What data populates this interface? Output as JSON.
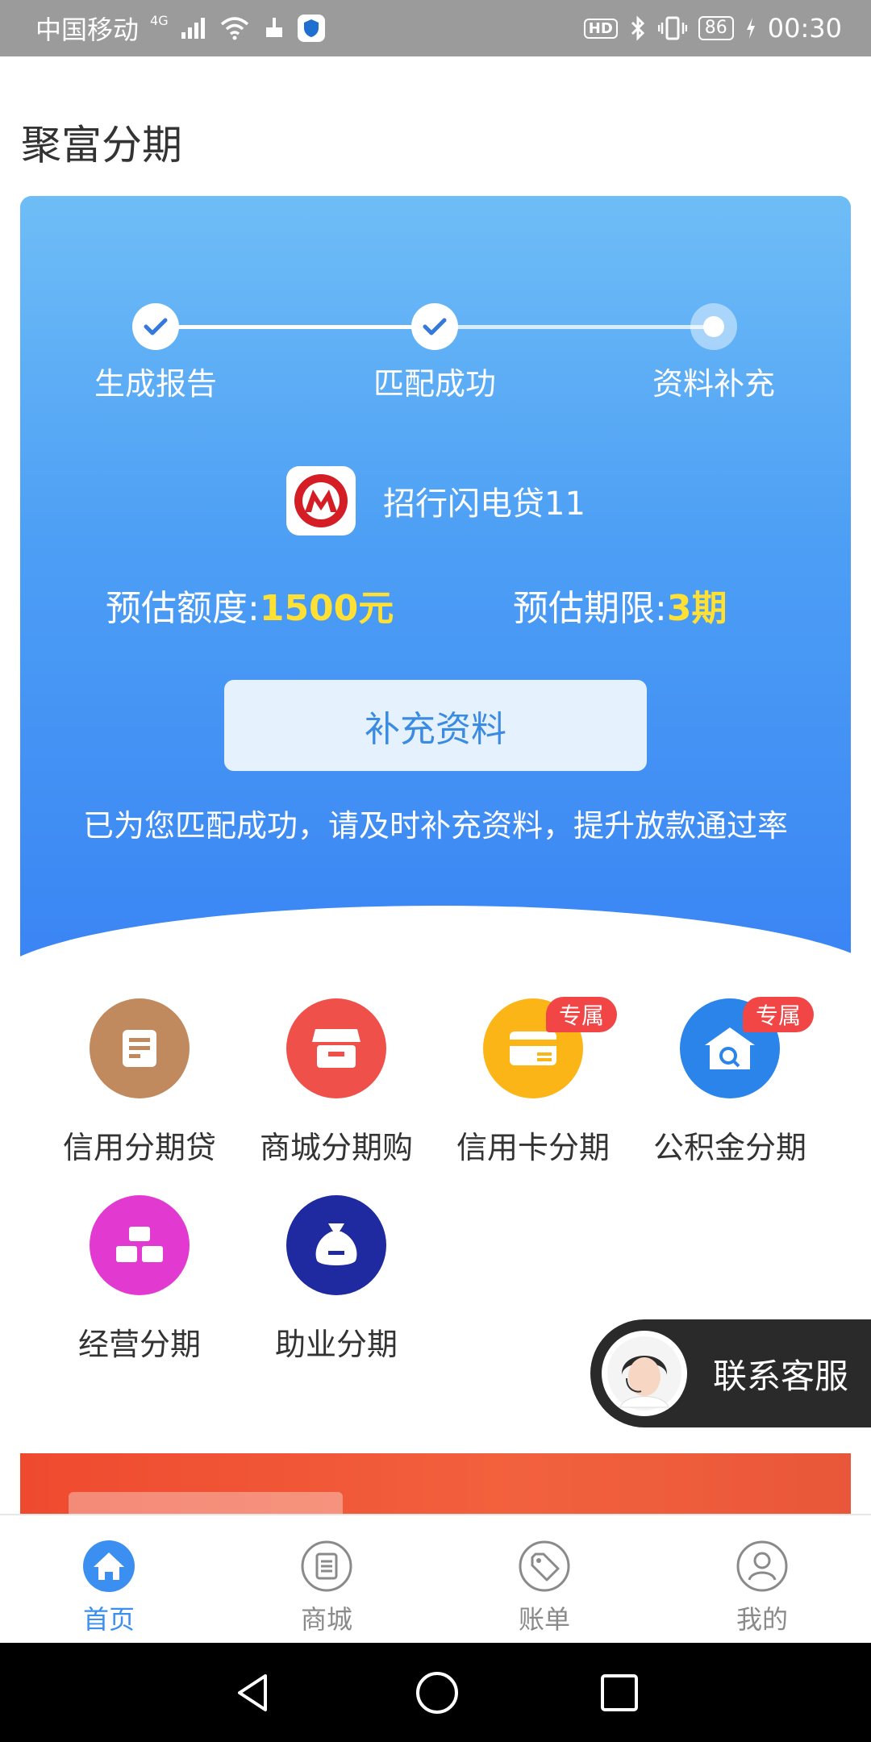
{
  "status_bar": {
    "carrier": "中国移动",
    "network": "4G",
    "hd": "HD",
    "battery": "86",
    "time": "00:30"
  },
  "header": {
    "title": "聚富分期"
  },
  "progress": {
    "steps": [
      {
        "label": "生成报告",
        "state": "done"
      },
      {
        "label": "匹配成功",
        "state": "done"
      },
      {
        "label": "资料补充",
        "state": "current"
      }
    ]
  },
  "loan": {
    "bank_name": "招行闪电贷11",
    "amount_label": "预估额度:",
    "amount_value": "1500元",
    "term_label": "预估期限:",
    "term_value": "3期",
    "action_label": "补充资料",
    "hint": "已为您匹配成功，请及时补充资料，提升放款通过率"
  },
  "menu": [
    {
      "label": "信用分期贷",
      "icon": "document-icon",
      "color": "#c08a5e",
      "badge": ""
    },
    {
      "label": "商城分期购",
      "icon": "store-icon",
      "color": "#f0504a",
      "badge": ""
    },
    {
      "label": "信用卡分期",
      "icon": "credit-card-icon",
      "color": "#fcb516",
      "badge": "专属"
    },
    {
      "label": "公积金分期",
      "icon": "house-search-icon",
      "color": "#2a84ea",
      "badge": "专属"
    },
    {
      "label": "经营分期",
      "icon": "gold-bars-icon",
      "color": "#e23ad0",
      "badge": ""
    },
    {
      "label": "助业分期",
      "icon": "money-bag-icon",
      "color": "#1f2aa0",
      "badge": ""
    }
  ],
  "contact": {
    "label": "联系客服"
  },
  "bottom_nav": [
    {
      "label": "首页",
      "icon": "home-icon",
      "active": true
    },
    {
      "label": "商城",
      "icon": "mall-icon",
      "active": false
    },
    {
      "label": "账单",
      "icon": "tag-icon",
      "active": false
    },
    {
      "label": "我的",
      "icon": "user-icon",
      "active": false
    }
  ]
}
